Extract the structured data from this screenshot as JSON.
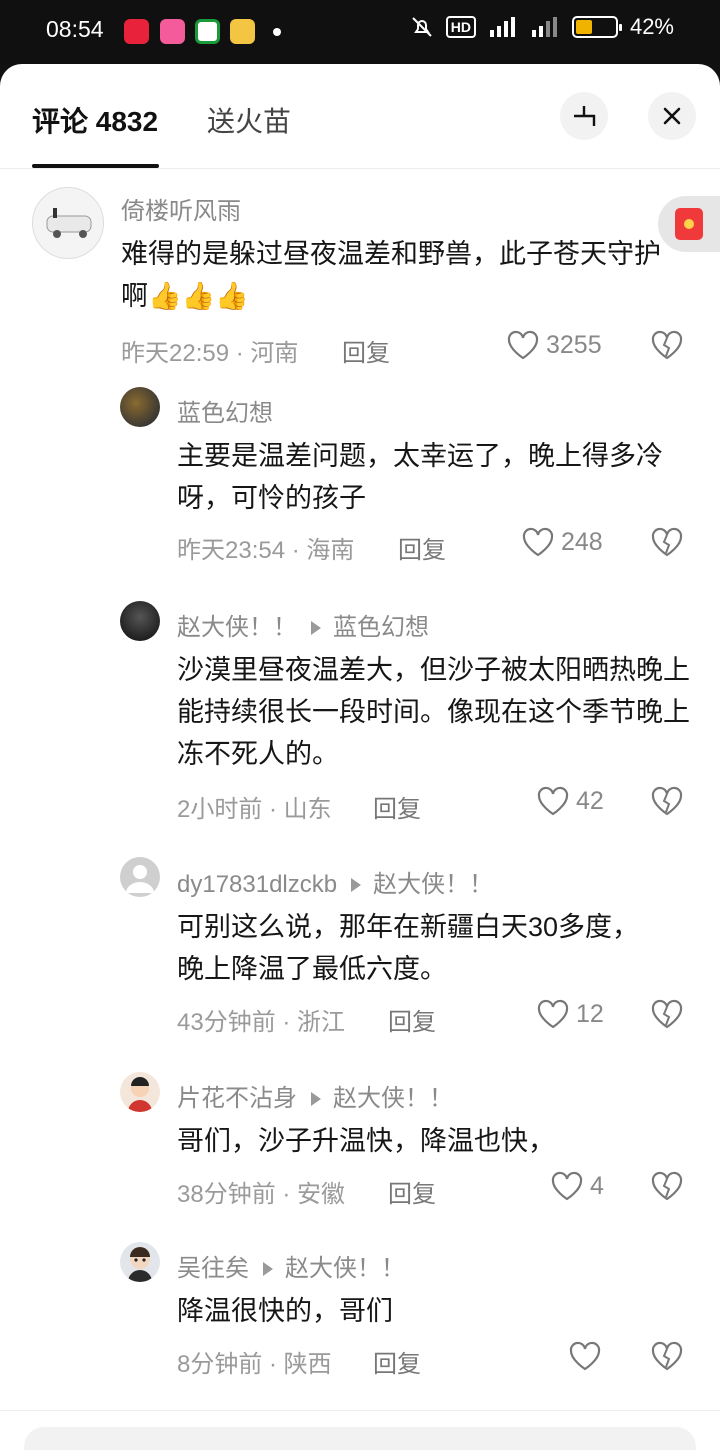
{
  "status_bar": {
    "time": "08:54",
    "battery_percent": "42%",
    "battery_level": 0.42,
    "icons": [
      "mute-icon",
      "hd-icon",
      "signal-5g-icon",
      "signal-5g-icon",
      "battery-icon"
    ]
  },
  "header": {
    "comments_tab": "评论 4832",
    "gift_tab": "送火苗"
  },
  "comments": [
    {
      "user": "倚楼听风雨",
      "text": "难得的是躲过昼夜温差和野兽，此子苍天守护啊",
      "emoji": "👍👍👍",
      "meta": "昨天22:59 · 河南",
      "reply": "回复",
      "likes": "3255"
    },
    {
      "user": "蓝色幻想",
      "text": "主要是温差问题，太幸运了，晚上得多冷呀，可怜的孩子",
      "meta": "昨天23:54 · 海南",
      "reply": "回复",
      "likes": "248"
    },
    {
      "user": "赵大侠！！",
      "reply_to": "蓝色幻想",
      "text": "沙漠里昼夜温差大，但沙子被太阳晒热晚上能持续很长一段时间。像现在这个季节晚上冻不死人的。",
      "meta": "2小时前 · 山东",
      "reply": "回复",
      "likes": "42"
    },
    {
      "user": "dy17831dlzckb",
      "reply_to": "赵大侠！！",
      "text": "可别这么说，那年在新疆白天30多度，晚上降温了最低六度。",
      "meta": "43分钟前 · 浙江",
      "reply": "回复",
      "likes": "12"
    },
    {
      "user": "片花不沾身",
      "reply_to": "赵大侠！！",
      "text": "哥们，沙子升温快，降温也快，",
      "meta": "38分钟前 · 安徽",
      "reply": "回复",
      "likes": "4"
    },
    {
      "user": "吴往矣",
      "reply_to": "赵大侠！！",
      "text": "降温很快的，哥们",
      "meta": "8分钟前 · 陕西",
      "reply": "回复",
      "likes": ""
    }
  ]
}
